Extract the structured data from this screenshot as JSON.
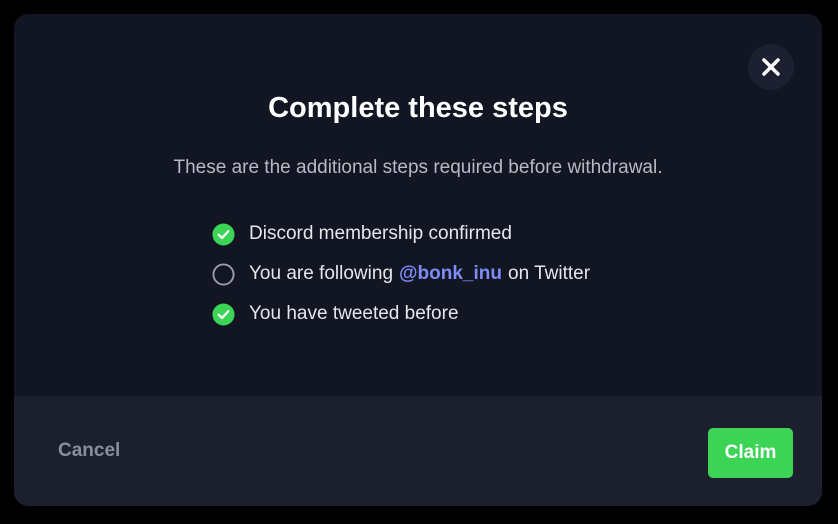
{
  "modal": {
    "title": "Complete these steps",
    "subtitle": "These are the additional steps required before withdrawal.",
    "close_icon": "close-icon"
  },
  "steps": [
    {
      "label": "Discord membership confirmed",
      "status": "completed",
      "icon": "check-circle-icon"
    },
    {
      "prefix": "You are following",
      "handle": "@bonk_inu",
      "suffix": "on Twitter",
      "status": "pending",
      "icon": "empty-circle-icon"
    },
    {
      "label": "You have tweeted before",
      "status": "completed",
      "icon": "check-circle-icon"
    }
  ],
  "footer": {
    "cancel_label": "Cancel",
    "claim_label": "Claim"
  },
  "colors": {
    "accent_green": "#3bd455",
    "handle_blue": "#7d8cf6",
    "modal_bg": "#121522",
    "footer_bg": "#1b1f2e"
  }
}
